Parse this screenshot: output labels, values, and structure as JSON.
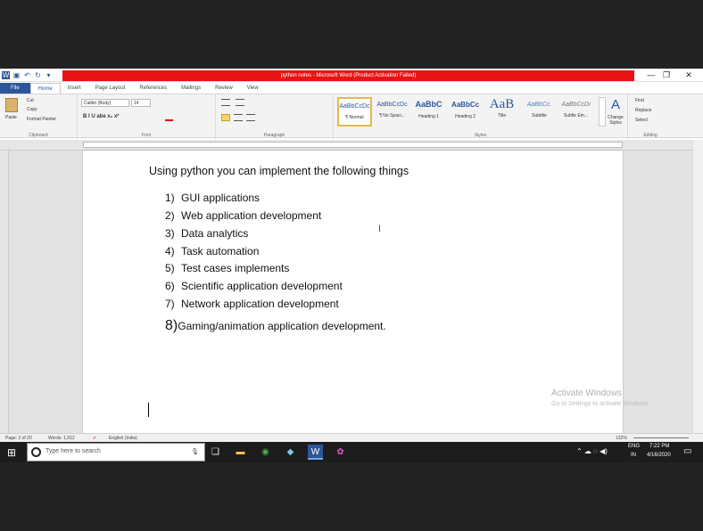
{
  "app": {
    "title": "python notes - Microsoft Word (Product Activation Failed)",
    "win_minimize": "—",
    "win_restore": "❐",
    "win_close": "✕"
  },
  "qat": {
    "word_icon": "W",
    "save_icon": "▣",
    "undo_icon": "↶",
    "redo_icon": "↻",
    "more_icon": "▾"
  },
  "tabs": [
    "File",
    "Home",
    "Insert",
    "Page Layout",
    "References",
    "Mailings",
    "Review",
    "View"
  ],
  "ribbon": {
    "clipboard": {
      "paste": "Paste",
      "cut": "Cut",
      "copy": "Copy",
      "format_painter": "Format Painter",
      "label": "Clipboard"
    },
    "font": {
      "family": "Calibri (Body)",
      "size": "14",
      "label": "Font",
      "row2": "B  I  U  abe  x₂  x²"
    },
    "paragraph": {
      "label": "Paragraph"
    },
    "styles": {
      "items": [
        {
          "preview": "AaBbCcDc",
          "name": "¶ Normal"
        },
        {
          "preview": "AaBbCcDc",
          "name": "¶ No Spaci..."
        },
        {
          "preview": "AaBbC",
          "name": "Heading 1"
        },
        {
          "preview": "AaBbCc",
          "name": "Heading 2"
        },
        {
          "preview": "AaB",
          "name": "Title"
        },
        {
          "preview": "AaBbCc.",
          "name": "Subtitle"
        },
        {
          "preview": "AaBbCcDi",
          "name": "Subtle Em..."
        }
      ],
      "change_styles": "Change Styles",
      "label": "Styles"
    },
    "editing": {
      "find": "Find",
      "replace": "Replace",
      "select": "Select",
      "label": "Editing"
    }
  },
  "document": {
    "heading": "Using python you can implement the following things",
    "items": [
      {
        "num": "1)",
        "text": "GUI applications"
      },
      {
        "num": "2)",
        "text": "Web application development"
      },
      {
        "num": "3)",
        "text": "Data analytics"
      },
      {
        "num": "4)",
        "text": "Task automation"
      },
      {
        "num": "5)",
        "text": "Test cases implements"
      },
      {
        "num": "6)",
        "text": "Scientific application development"
      },
      {
        "num": "7)",
        "text": "Network application development"
      }
    ],
    "item8": {
      "num": "8)",
      "text": "Gaming/animation application development."
    }
  },
  "watermark": {
    "line1": "Activate Windows",
    "line2": "Go to Settings to activate Windows."
  },
  "status": {
    "page": "Page: 2 of 20",
    "words": "Words: 1,912",
    "language": "English (India)",
    "zoom": "132%"
  },
  "taskbar": {
    "search_placeholder": "Type here to search",
    "lang_top": "ENG",
    "lang_bottom": "IN",
    "time": "7:22 PM",
    "date": "4/16/2020"
  }
}
